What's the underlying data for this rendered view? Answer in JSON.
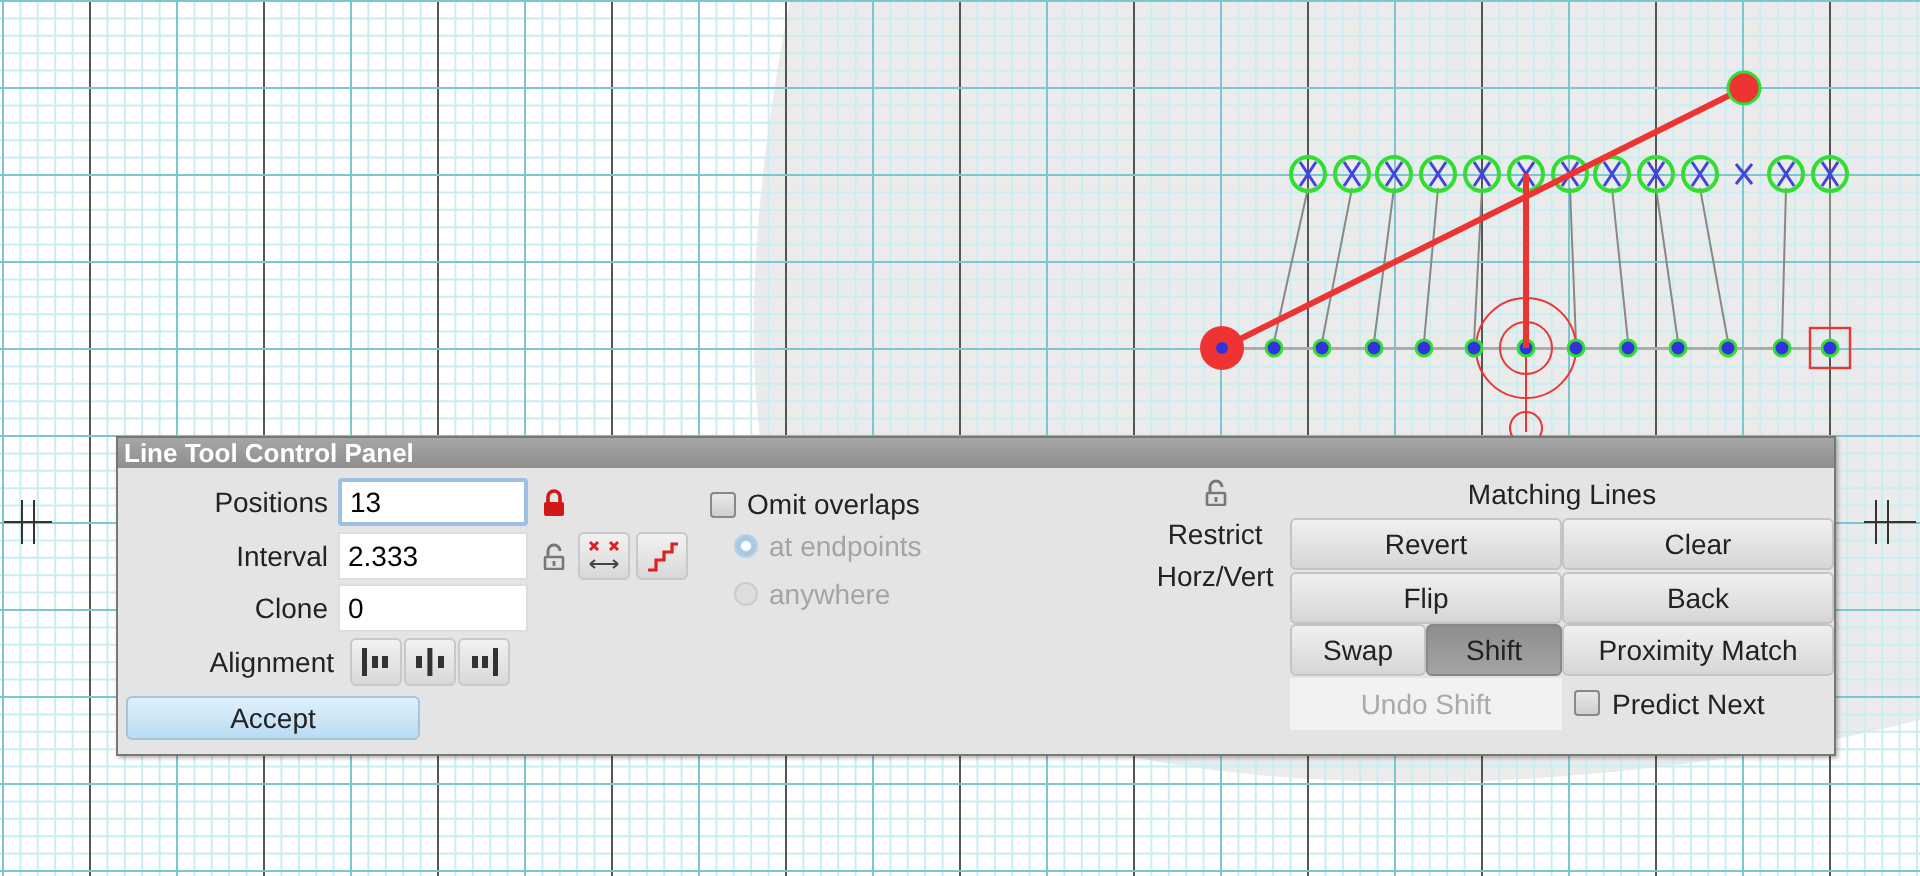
{
  "panel": {
    "title": "Line Tool Control Panel",
    "positions": {
      "label": "Positions",
      "value": "13",
      "focused": true,
      "locked": true
    },
    "interval": {
      "label": "Interval",
      "value": "2.333",
      "focused": false,
      "locked": false
    },
    "clone": {
      "label": "Clone",
      "value": "0",
      "focused": false
    },
    "alignment": {
      "label": "Alignment"
    },
    "accept": "Accept",
    "omit_overlaps": {
      "label": "Omit overlaps",
      "checked": false
    },
    "overlap_options": [
      {
        "label": "at endpoints",
        "selected": true,
        "disabled": true
      },
      {
        "label": "anywhere",
        "selected": false,
        "disabled": true
      }
    ],
    "restrict": {
      "label": "Restrict Horz/Vert",
      "locked": false
    },
    "matching_lines": {
      "title": "Matching Lines",
      "rows": [
        [
          {
            "label": "Revert",
            "selected": false,
            "disabled": false
          },
          {
            "label": "Clear",
            "selected": false,
            "disabled": false
          }
        ],
        [
          {
            "label": "Flip",
            "selected": false,
            "disabled": false
          },
          {
            "label": "Back",
            "selected": false,
            "disabled": false
          }
        ],
        [
          {
            "label": "Swap",
            "selected": false,
            "disabled": false
          },
          {
            "label": "Shift",
            "selected": true,
            "disabled": false
          },
          {
            "label": "Proximity Match",
            "selected": false,
            "disabled": false
          }
        ]
      ],
      "undo": {
        "label": "Undo Shift",
        "disabled": true
      },
      "predict_next": {
        "label": "Predict Next",
        "checked": false
      }
    }
  }
}
